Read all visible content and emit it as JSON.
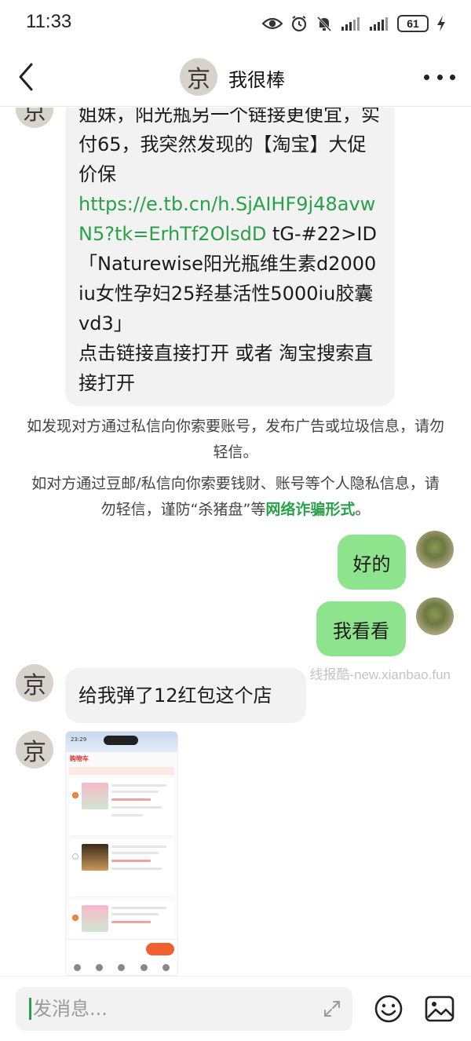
{
  "status_bar": {
    "time": "11:33",
    "battery": "61"
  },
  "header": {
    "avatar_char": "京",
    "title": "我很棒"
  },
  "messages": {
    "first": {
      "avatar_char": "京",
      "line1": "姐妹，阳光瓶另一个链接更便宜，实付65，我突然发现的【淘宝】大促价保",
      "link": "https://e.tb.cn/h.SjAIHF9j48avwN5?tk=ErhTf2OlsdD",
      "code": " tG-#22>ID",
      "product": "「Naturewise阳光瓶维生素d2000iu女性孕妇25羟基活性5000iu胶囊vd3」",
      "action": "点击链接直接打开 或者 淘宝搜索直接打开"
    },
    "notice1": "如发现对方通过私信向你索要账号，发布广告或垃圾信息，请勿轻信。",
    "notice2_pre": "如对方通过豆邮/私信向你索要钱财、账号等个人隐私信息，请勿轻信，谨防“杀猪盘”等",
    "notice2_link": "网络诈骗形式",
    "notice2_post": "。",
    "reply1": "好的",
    "reply2": "我看看",
    "third": {
      "avatar_char": "京",
      "text": "给我弹了12红包这个店"
    },
    "fourth": {
      "avatar_char": "京",
      "screenshot": {
        "time": "23:29",
        "title": "购物车"
      }
    }
  },
  "watermark": "线报酷-new.xianbao.fun",
  "input": {
    "placeholder": "发消息..."
  },
  "icons": {
    "back": "back-arrow-icon",
    "more": "more-dots-icon",
    "expand": "expand-icon",
    "emoji": "emoji-icon",
    "image": "image-icon"
  }
}
